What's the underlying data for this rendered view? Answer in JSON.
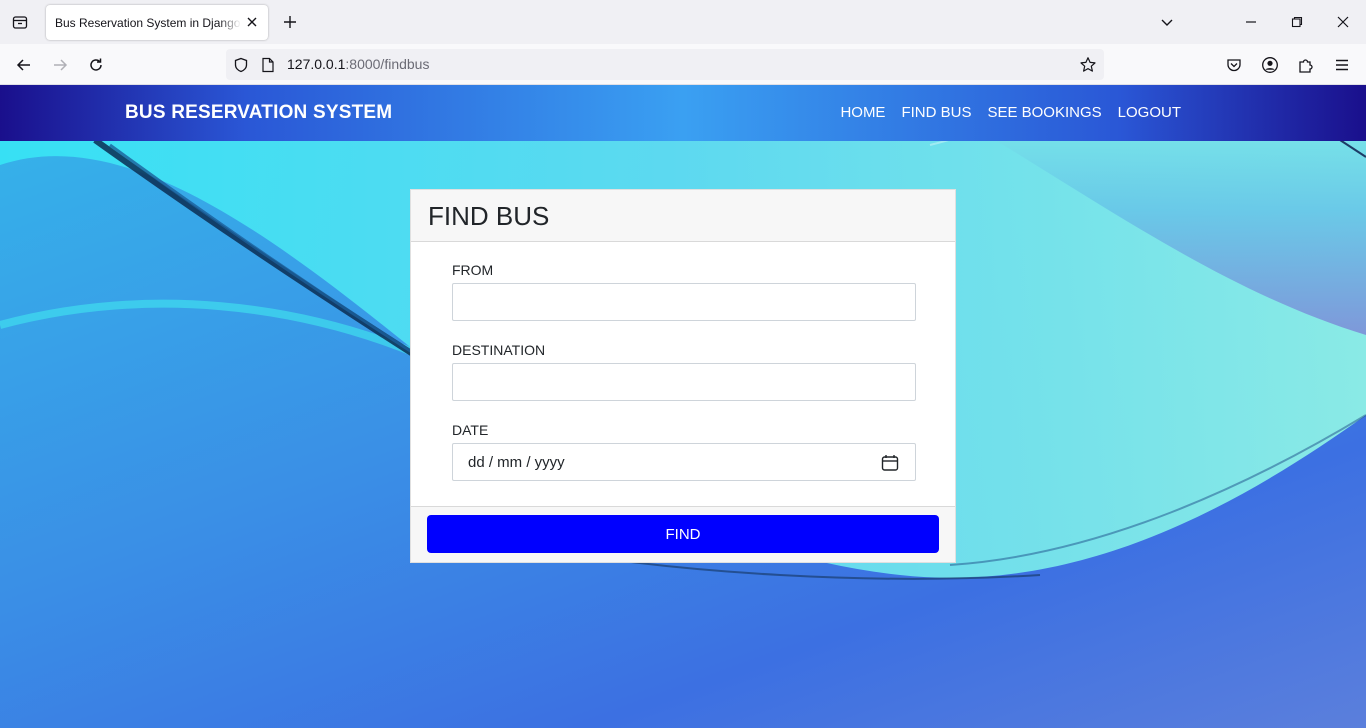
{
  "browser": {
    "tab_title": "Bus Reservation System in Django Framework",
    "url_host": "127.0.0.1",
    "url_path": ":8000/findbus"
  },
  "site": {
    "brand": "BUS RESERVATION SYSTEM",
    "nav": [
      "HOME",
      "FIND BUS",
      "SEE BOOKINGS",
      "LOGOUT"
    ]
  },
  "form": {
    "title": "FIND BUS",
    "from_label": "FROM",
    "from_value": "",
    "destination_label": "DESTINATION",
    "destination_value": "",
    "date_label": "DATE",
    "date_placeholder": "dd / mm / yyyy",
    "submit_label": "FIND"
  },
  "colors": {
    "submit_button": "#0000ff",
    "navbar_edge": "#1a0f8c",
    "navbar_center": "#3aa0f2"
  }
}
